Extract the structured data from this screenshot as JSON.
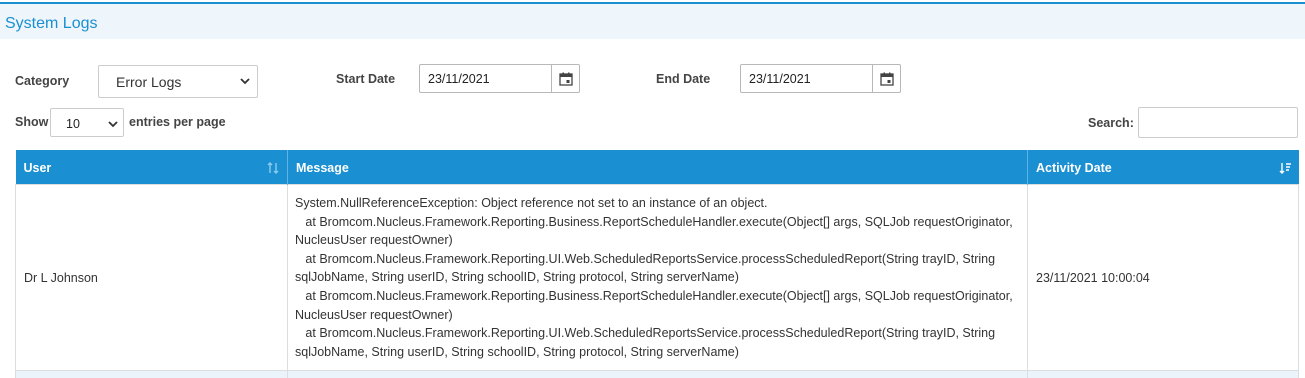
{
  "page": {
    "title": "System Logs"
  },
  "filters": {
    "category_label": "Category",
    "category_value": "Error Logs",
    "start_date_label": "Start Date",
    "start_date_value": "23/11/2021",
    "end_date_label": "End Date",
    "end_date_value": "23/11/2021"
  },
  "table_controls": {
    "show_label": "Show",
    "entries_value": "10",
    "entries_suffix": "entries per page",
    "search_label": "Search:",
    "search_value": ""
  },
  "table": {
    "columns": [
      "User",
      "Message",
      "Activity Date"
    ],
    "rows": [
      {
        "user": "Dr L Johnson",
        "message": "System.NullReferenceException: Object reference not set to an instance of an object.\n   at Bromcom.Nucleus.Framework.Reporting.Business.ReportScheduleHandler.execute(Object[] args, SQLJob requestOriginator, NucleusUser requestOwner)\n   at Bromcom.Nucleus.Framework.Reporting.UI.Web.ScheduledReportsService.processScheduledReport(String trayID, String sqlJobName, String userID, String schoolID, String protocol, String serverName)\n   at Bromcom.Nucleus.Framework.Reporting.Business.ReportScheduleHandler.execute(Object[] args, SQLJob requestOriginator, NucleusUser requestOwner)\n   at Bromcom.Nucleus.Framework.Reporting.UI.Web.ScheduledReportsService.processScheduledReport(String trayID, String sqlJobName, String userID, String schoolID, String protocol, String serverName)",
        "activity_date": "23/11/2021 10:00:04"
      }
    ]
  },
  "colors": {
    "accent": "#1a8fd1",
    "header_bg": "#eef6fb"
  },
  "icons": [
    "calendar-icon",
    "chevron-down-icon",
    "sort-icon",
    "sort-desc-icon"
  ]
}
